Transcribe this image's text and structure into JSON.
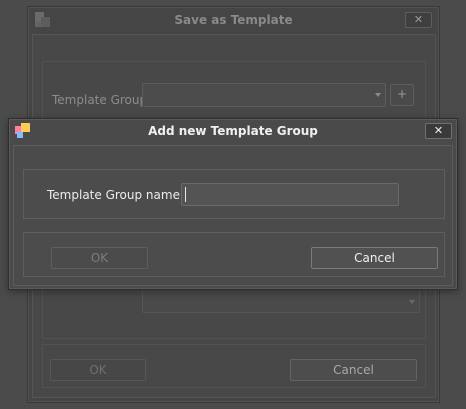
{
  "background_window": {
    "title": "Save as Template",
    "close_label": "✕",
    "template_group_label": "Template Group",
    "add_button_label": "+",
    "ok_label": "OK",
    "cancel_label": "Cancel"
  },
  "dialog": {
    "title": "Add new Template Group",
    "close_label": "✕",
    "field_label": "Template Group name",
    "field_value": "",
    "ok_label": "OK",
    "cancel_label": "Cancel"
  },
  "colors": {
    "background": "#4b4b4b",
    "dialog_bg": "#4a4a4a",
    "text": "#e6e6e6",
    "disabled_text": "#7c7c7c",
    "icon_pink": "#ff7fa8",
    "icon_yellow": "#ffcc55",
    "icon_blue": "#7fbfff"
  },
  "icons": {
    "app_icon": "template-app-icon",
    "close_icon": "close-icon",
    "dropdown_icon": "chevron-down-icon"
  }
}
